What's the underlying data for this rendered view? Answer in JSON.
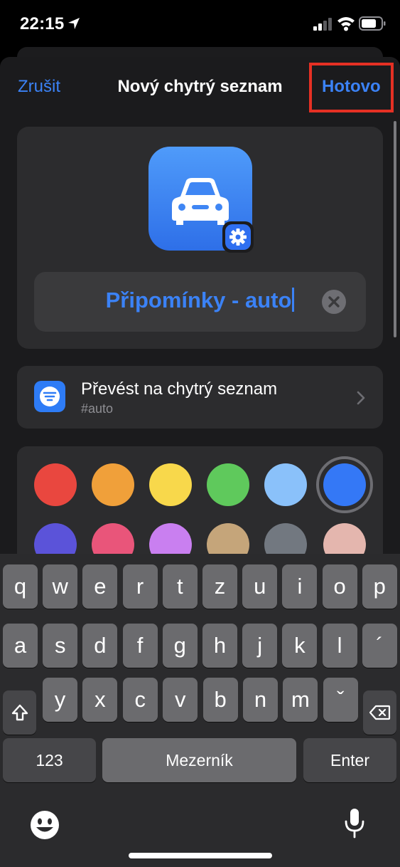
{
  "status": {
    "time": "22:15",
    "icons": [
      "location-arrow-icon",
      "signal-icon",
      "wifi-icon",
      "battery-icon"
    ]
  },
  "nav": {
    "cancel": "Zrušit",
    "title": "Nový chytrý seznam",
    "done": "Hotovo"
  },
  "header": {
    "icon": "car-icon",
    "badge": "gear-icon",
    "name_value": "Připomínky - auto"
  },
  "convert": {
    "title": "Převést na chytrý seznam",
    "subtitle": "#auto"
  },
  "colors": {
    "selected": "#3478f6",
    "swatches": [
      "#e9473f",
      "#f0a03a",
      "#f8d84b",
      "#5fc95c",
      "#8ac1fa",
      "#3478f6",
      "#5b53d9",
      "#e9557a",
      "#c97ff0",
      "#c5a57a",
      "#727880",
      "#e4b6ae"
    ]
  },
  "keyboard": {
    "row1": [
      "q",
      "w",
      "e",
      "r",
      "t",
      "z",
      "u",
      "i",
      "o",
      "p"
    ],
    "row2": [
      "a",
      "s",
      "d",
      "f",
      "g",
      "h",
      "j",
      "k",
      "l",
      "´"
    ],
    "row3": [
      "y",
      "x",
      "c",
      "v",
      "b",
      "n",
      "m",
      "ˇ"
    ],
    "numbers": "123",
    "space": "Mezerník",
    "enter": "Enter"
  }
}
